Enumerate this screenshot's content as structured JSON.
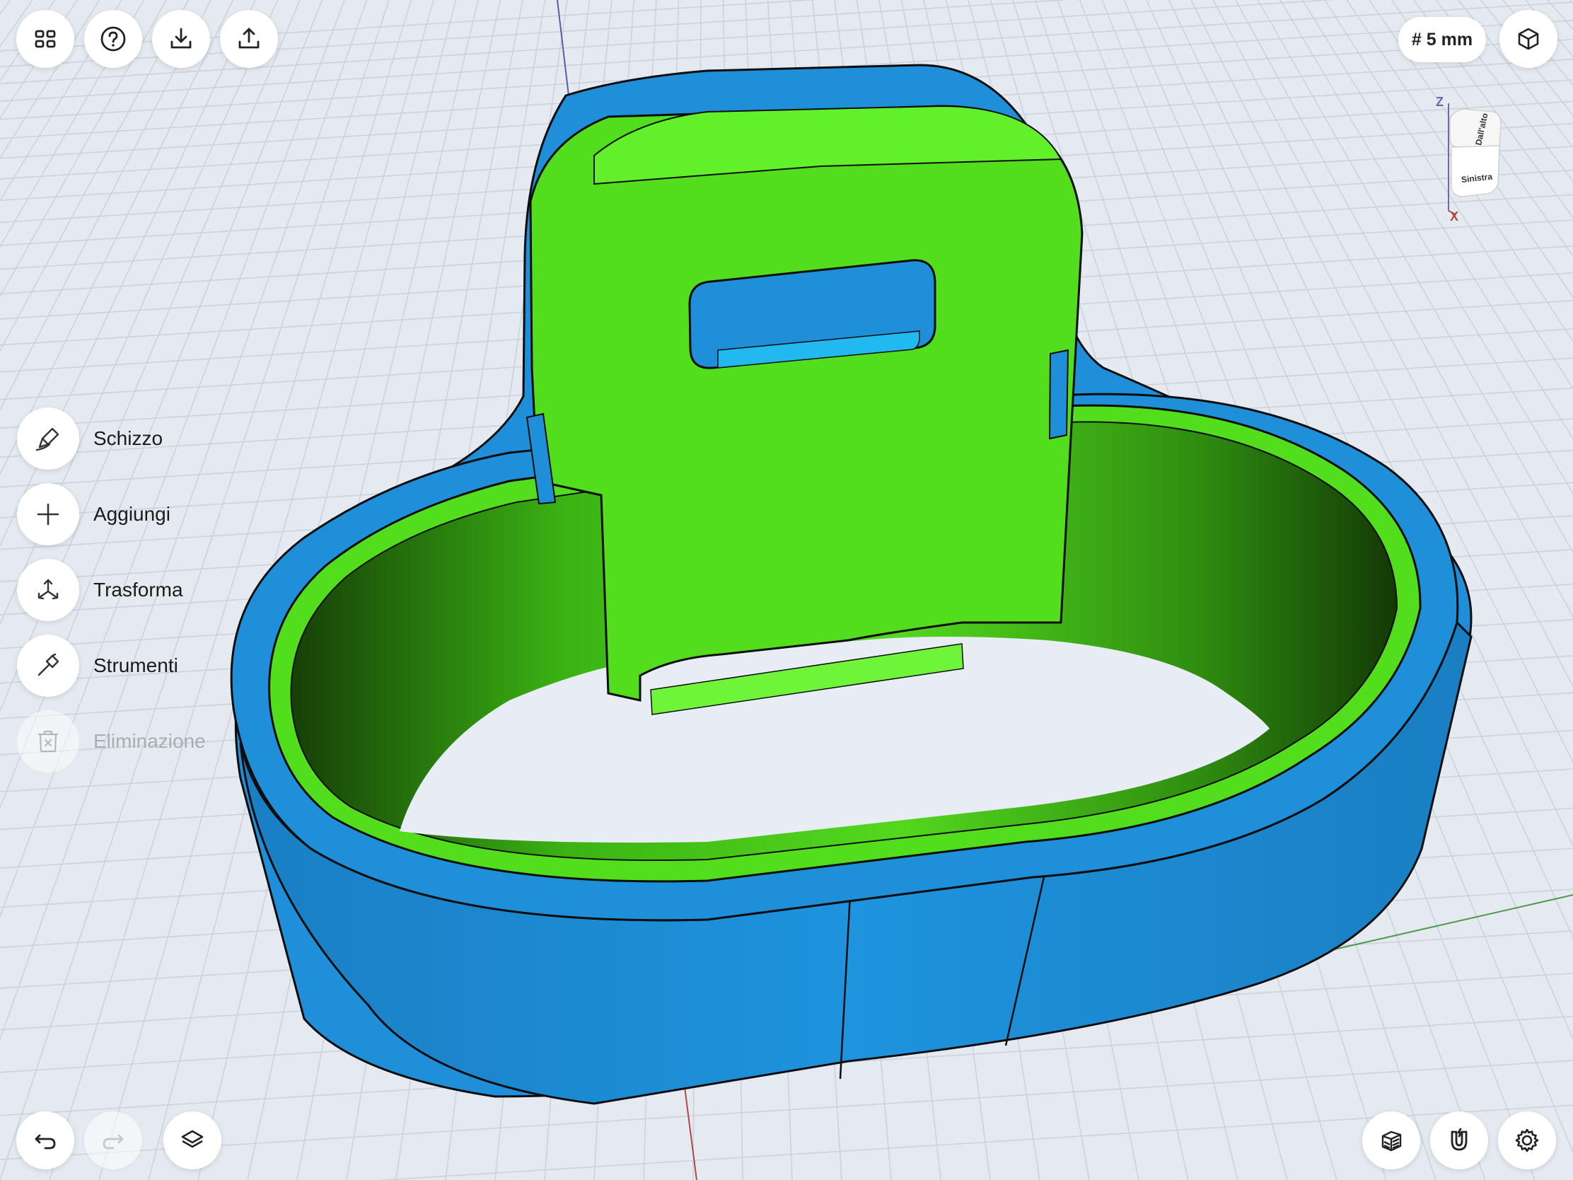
{
  "toolbar_top_left": [
    {
      "name": "grid-view-button",
      "icon": "grid-icon"
    },
    {
      "name": "help-button",
      "icon": "question-icon"
    },
    {
      "name": "import-button",
      "icon": "download-icon"
    },
    {
      "name": "export-button",
      "icon": "share-icon"
    }
  ],
  "top_right": {
    "grid_size_label": "# 5 mm",
    "view_mode_icon": "cube-outline-icon"
  },
  "viewcube": {
    "axis_z": "Z",
    "axis_x": "X",
    "face_top": "Dall'alto",
    "face_front": "Sinistra"
  },
  "tools": [
    {
      "label": "Schizzo",
      "icon": "pencil-icon",
      "enabled": true
    },
    {
      "label": "Aggiungi",
      "icon": "plus-icon",
      "enabled": true
    },
    {
      "label": "Trasforma",
      "icon": "transform-arrows-icon",
      "enabled": true
    },
    {
      "label": "Strumenti",
      "icon": "hammer-icon",
      "enabled": true
    },
    {
      "label": "Eliminazione",
      "icon": "trash-icon",
      "enabled": false
    }
  ],
  "bottom_left": [
    {
      "name": "undo-button",
      "icon": "undo-icon",
      "enabled": true
    },
    {
      "name": "redo-button",
      "icon": "redo-icon",
      "enabled": false
    },
    {
      "name": "layers-button",
      "icon": "layers-icon",
      "enabled": true
    }
  ],
  "bottom_right": [
    {
      "name": "material-button",
      "icon": "hatched-cube-icon"
    },
    {
      "name": "snap-button",
      "icon": "magnet-icon"
    },
    {
      "name": "settings-button",
      "icon": "gear-icon"
    }
  ],
  "colors": {
    "background": "#e4eaf0",
    "grid_line": "#c9d2dc",
    "blue_part": "#1e8fd8",
    "blue_part_dark": "#1874b4",
    "green_part": "#52de1c",
    "green_part_dark": "#1f5c07",
    "axis_x": "#b44848",
    "axis_y": "#4e9a4e",
    "axis_z": "#5a5aa8"
  }
}
